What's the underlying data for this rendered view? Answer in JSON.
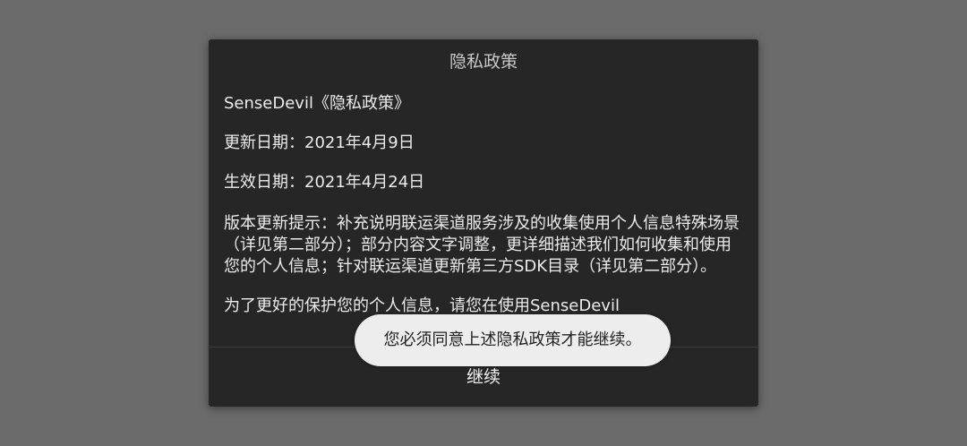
{
  "dialog": {
    "title": "隐私政策",
    "paragraphs": [
      "SenseDevil《隐私政策》",
      "更新日期：2021年4月9日",
      "生效日期：2021年4月24日",
      "版本更新提示：补充说明联运渠道服务涉及的收集使用个人信息特殊场景（详见第二部分）；部分内容文字调整，更详细描述我们如何收集和使用您的个人信息；针对联运渠道更新第三方SDK目录（详见第二部分）。",
      "为了更好的保护您的个人信息，请您在使用SenseDevil"
    ],
    "continue_label": "继续"
  },
  "toast": {
    "message": "您必须同意上述隐私政策才能继续。"
  }
}
